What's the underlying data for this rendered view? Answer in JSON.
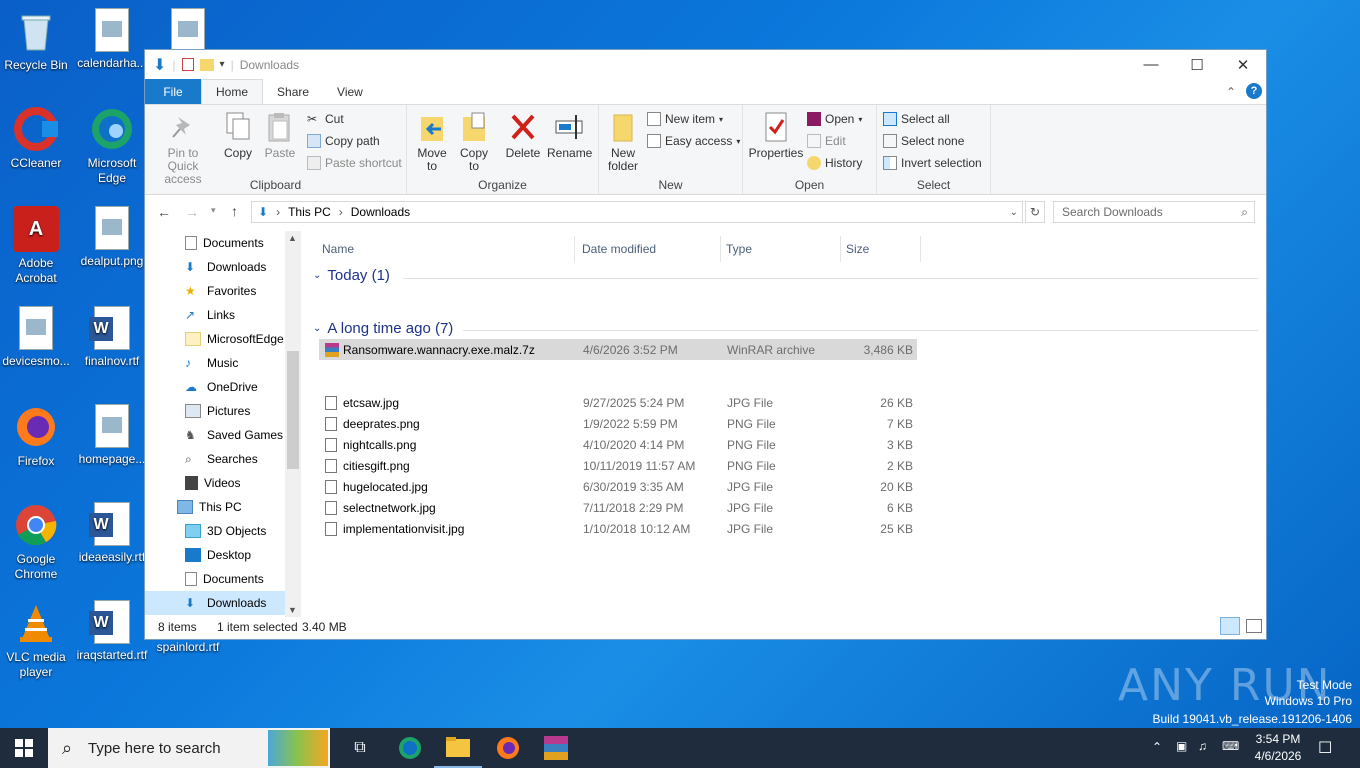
{
  "desktop": {
    "icons": [
      {
        "label": "Recycle Bin"
      },
      {
        "label": "calendarha..."
      },
      {
        "label": "CCleaner"
      },
      {
        "label": "Microsoft Edge"
      },
      {
        "label": "Adobe Acrobat"
      },
      {
        "label": "dealput.png"
      },
      {
        "label": "devicesmo..."
      },
      {
        "label": "finalnov.rtf"
      },
      {
        "label": "Firefox"
      },
      {
        "label": "homepage..."
      },
      {
        "label": "Google Chrome"
      },
      {
        "label": "ideaeasily.rtf"
      },
      {
        "label": "VLC media player"
      },
      {
        "label": "iraqstarted.rtf"
      },
      {
        "label": "spainlord.rtf"
      }
    ]
  },
  "window": {
    "title": "Downloads",
    "tabs": [
      "File",
      "Home",
      "Share",
      "View"
    ],
    "ribbon": {
      "clipboard": {
        "label": "Clipboard",
        "pin": "Pin to Quick access",
        "copy": "Copy",
        "paste": "Paste",
        "cut": "Cut",
        "copy_path": "Copy path",
        "paste_shortcut": "Paste shortcut"
      },
      "organize": {
        "label": "Organize",
        "move_to": "Move to",
        "copy_to": "Copy to",
        "delete": "Delete",
        "rename": "Rename"
      },
      "new": {
        "label": "New",
        "new_folder": "New folder",
        "new_item": "New item",
        "easy_access": "Easy access"
      },
      "open": {
        "label": "Open",
        "properties": "Properties",
        "open": "Open",
        "edit": "Edit",
        "history": "History"
      },
      "select": {
        "label": "Select",
        "select_all": "Select all",
        "select_none": "Select none",
        "invert": "Invert selection"
      }
    },
    "address": {
      "crumbs": [
        "This PC",
        "Downloads"
      ],
      "search_placeholder": "Search Downloads"
    },
    "nav": [
      {
        "label": "Documents"
      },
      {
        "label": "Downloads"
      },
      {
        "label": "Favorites"
      },
      {
        "label": "Links"
      },
      {
        "label": "MicrosoftEdge"
      },
      {
        "label": "Music"
      },
      {
        "label": "OneDrive"
      },
      {
        "label": "Pictures"
      },
      {
        "label": "Saved Games"
      },
      {
        "label": "Searches"
      },
      {
        "label": "Videos"
      },
      {
        "label": "This PC"
      },
      {
        "label": "3D Objects"
      },
      {
        "label": "Desktop"
      },
      {
        "label": "Documents"
      },
      {
        "label": "Downloads"
      }
    ],
    "columns": {
      "name": "Name",
      "date": "Date modified",
      "type": "Type",
      "size": "Size"
    },
    "groups": [
      {
        "title": "Today (1)",
        "files": [
          {
            "name": "Ransomware.wannacry.exe.malz.7z",
            "date": "4/6/2026 3:52 PM",
            "type": "WinRAR archive",
            "size": "3,486 KB"
          }
        ]
      },
      {
        "title": "A long time ago (7)",
        "files": [
          {
            "name": "etcsaw.jpg",
            "date": "9/27/2025 5:24 PM",
            "type": "JPG File",
            "size": "26 KB"
          },
          {
            "name": "deeprates.png",
            "date": "1/9/2022 5:59 PM",
            "type": "PNG File",
            "size": "7 KB"
          },
          {
            "name": "nightcalls.png",
            "date": "4/10/2020 4:14 PM",
            "type": "PNG File",
            "size": "3 KB"
          },
          {
            "name": "citiesgift.png",
            "date": "10/11/2019 11:57 AM",
            "type": "PNG File",
            "size": "2 KB"
          },
          {
            "name": "hugelocated.jpg",
            "date": "6/30/2019 3:35 AM",
            "type": "JPG File",
            "size": "20 KB"
          },
          {
            "name": "selectnetwork.jpg",
            "date": "7/11/2018 2:29 PM",
            "type": "JPG File",
            "size": "6 KB"
          },
          {
            "name": "implementationvisit.jpg",
            "date": "1/10/2018 10:12 AM",
            "type": "JPG File",
            "size": "25 KB"
          }
        ]
      }
    ],
    "status": {
      "count": "8 items",
      "selected": "1 item selected",
      "size": "3.40 MB"
    }
  },
  "taskbar": {
    "search_placeholder": "Type here to search",
    "time": "3:54 PM",
    "date": "4/6/2026"
  },
  "watermark": {
    "brand": "ANY RUN",
    "line1": "Test Mode",
    "line2": "Windows 10 Pro",
    "line3": "Build 19041.vb_release.191206-1406"
  },
  "colors": {
    "accent": "#1979ca",
    "selection": "#cce8ff",
    "taskbar": "#1e2c3e"
  }
}
